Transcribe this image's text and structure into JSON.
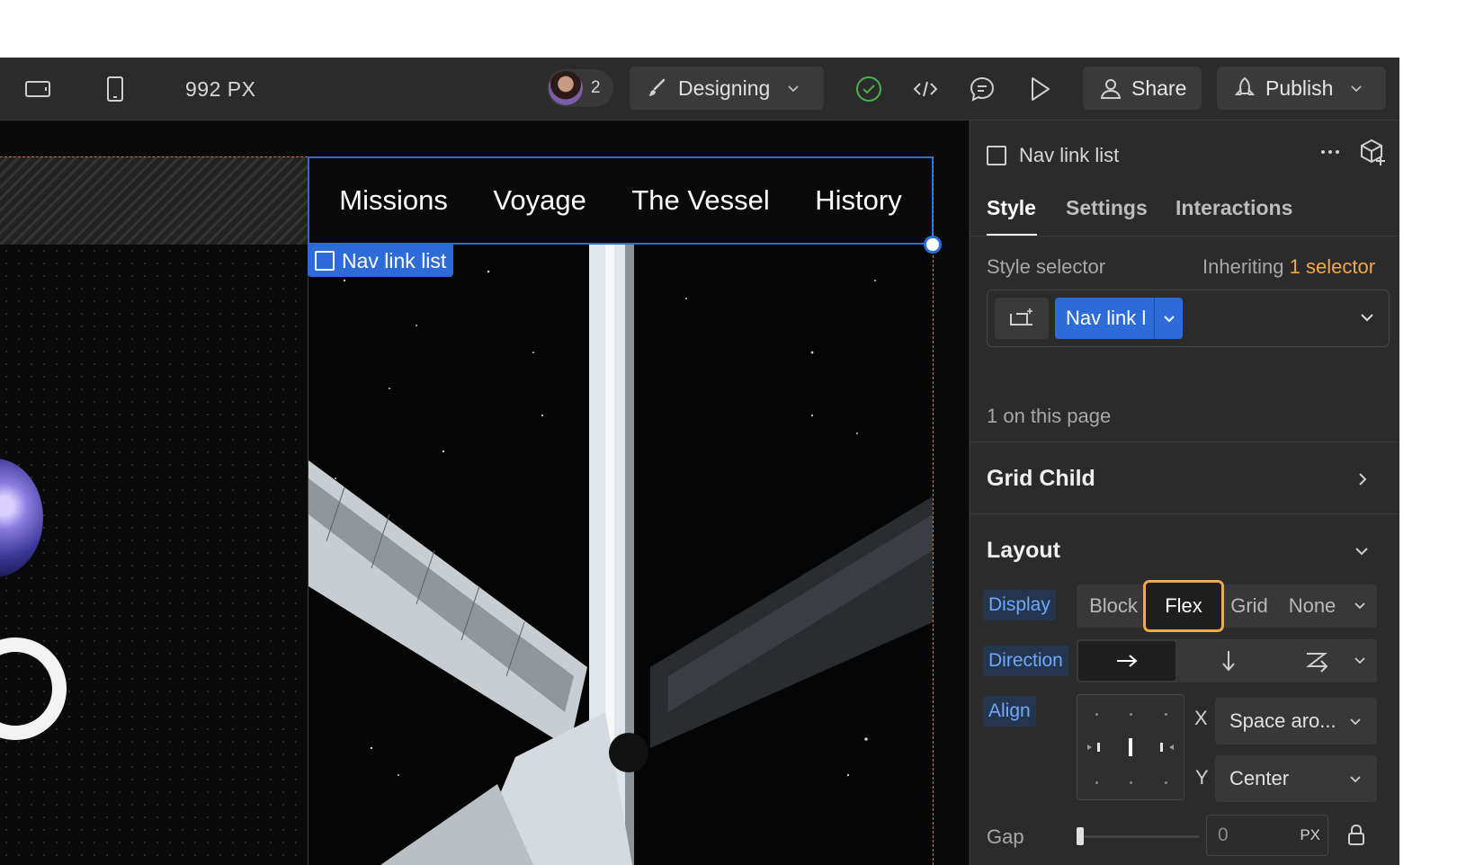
{
  "toolbar": {
    "viewport_width": "992 PX",
    "collaborators_count": "2",
    "mode_label": "Designing",
    "share_label": "Share",
    "publish_label": "Publish"
  },
  "canvas": {
    "nav_links": [
      "Missions",
      "Voyage",
      "The Vessel",
      "History"
    ],
    "selected_element_tag": "Nav link list"
  },
  "panel": {
    "element_name": "Nav link list",
    "tabs": [
      "Style",
      "Settings",
      "Interactions"
    ],
    "active_tab": "Style",
    "style_selector_label": "Style selector",
    "inheriting_prefix": "Inheriting",
    "inheriting_count": "1 selector",
    "selector_chip": "Nav link l",
    "on_page": "1 on this page",
    "grid_child_title": "Grid Child",
    "layout_title": "Layout",
    "display_label": "Display",
    "display_options": [
      "Block",
      "Flex",
      "Grid",
      "None"
    ],
    "display_selected": "Flex",
    "direction_label": "Direction",
    "align_label": "Align",
    "x_label": "X",
    "x_value": "Space aro...",
    "y_label": "Y",
    "y_value": "Center",
    "gap_label": "Gap",
    "gap_value": "0",
    "gap_unit": "PX"
  },
  "colors": {
    "accent_blue": "#2d6bd9",
    "highlight_orange": "#f0a94b",
    "inherit_orange": "#f0a94b",
    "status_green": "#4caf50"
  }
}
